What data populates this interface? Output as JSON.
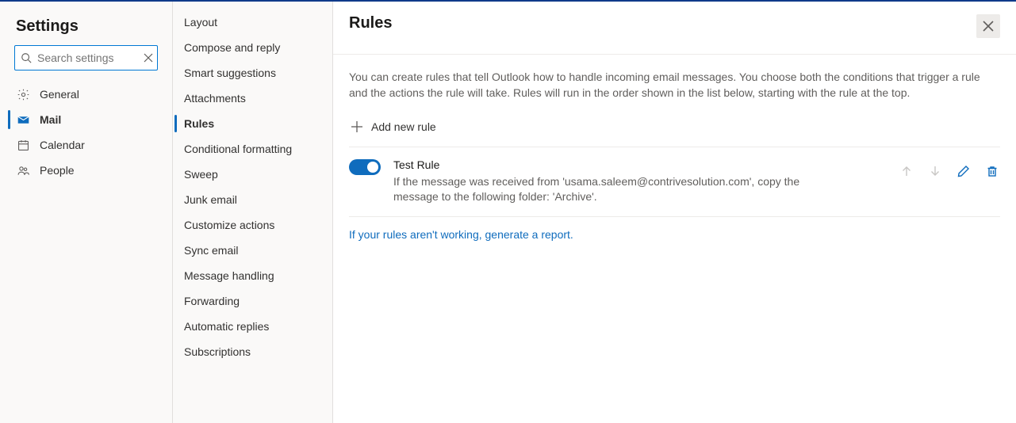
{
  "col1": {
    "title": "Settings",
    "search_placeholder": "Search settings",
    "items": [
      {
        "id": "general",
        "label": "General",
        "selected": false
      },
      {
        "id": "mail",
        "label": "Mail",
        "selected": true
      },
      {
        "id": "calendar",
        "label": "Calendar",
        "selected": false
      },
      {
        "id": "people",
        "label": "People",
        "selected": false
      }
    ]
  },
  "col2": {
    "items": [
      {
        "label": "Layout",
        "selected": false
      },
      {
        "label": "Compose and reply",
        "selected": false
      },
      {
        "label": "Smart suggestions",
        "selected": false
      },
      {
        "label": "Attachments",
        "selected": false
      },
      {
        "label": "Rules",
        "selected": true
      },
      {
        "label": "Conditional formatting",
        "selected": false
      },
      {
        "label": "Sweep",
        "selected": false
      },
      {
        "label": "Junk email",
        "selected": false
      },
      {
        "label": "Customize actions",
        "selected": false
      },
      {
        "label": "Sync email",
        "selected": false
      },
      {
        "label": "Message handling",
        "selected": false
      },
      {
        "label": "Forwarding",
        "selected": false
      },
      {
        "label": "Automatic replies",
        "selected": false
      },
      {
        "label": "Subscriptions",
        "selected": false
      }
    ]
  },
  "main": {
    "title": "Rules",
    "description": "You can create rules that tell Outlook how to handle incoming email messages. You choose both the conditions that trigger a rule and the actions the rule will take. Rules will run in the order shown in the list below, starting with the rule at the top.",
    "add_label": "Add new rule",
    "rules": [
      {
        "enabled": true,
        "name": "Test Rule",
        "description": "If the message was received from 'usama.saleem@contrivesolution.com', copy the message to the following folder: 'Archive'."
      }
    ],
    "report_link": "If your rules aren't working, generate a report."
  }
}
